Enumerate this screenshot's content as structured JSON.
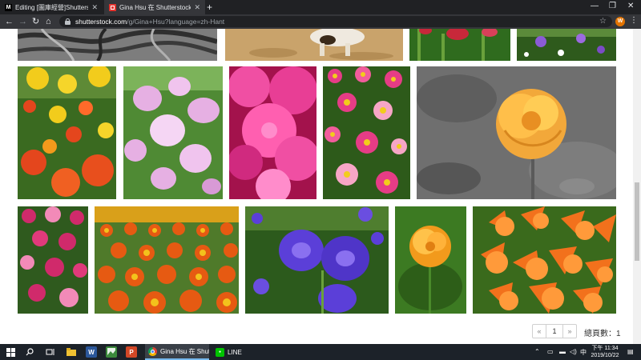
{
  "browser": {
    "tabs": [
      {
        "favicon": "M",
        "title": "Editing [圖庫經營]Shutterstock...",
        "active": false
      },
      {
        "favicon": "",
        "title": "Gina Hsu 在 Shutterstock 的作品...",
        "active": true
      }
    ],
    "new_tab": "+",
    "window_controls": {
      "minimize": "—",
      "maximize": "❐",
      "close": "✕"
    },
    "nav": {
      "back": "←",
      "forward": "→",
      "reload": "↻",
      "home": "⌂"
    },
    "url_host": "shutterstock.com",
    "url_rest": "/g/Gina+Hsu?language=zh-Hant",
    "bookmark_star": "☆",
    "profile_initial": "W",
    "menu_icon": "⋮"
  },
  "gallery": {
    "photos": [
      {
        "id": "roots-bw",
        "subject": "tree roots",
        "colors": [
          "#7a7a7a",
          "#2e2e2e",
          "#b5b5b5"
        ]
      },
      {
        "id": "sand-animal",
        "subject": "animal on sand",
        "colors": [
          "#c9a36b",
          "#a88550",
          "#e8e0d0"
        ]
      },
      {
        "id": "tulips-red",
        "subject": "red tulips",
        "colors": [
          "#2f6b1e",
          "#c8283a",
          "#6aa13b"
        ]
      },
      {
        "id": "flowers-purple-top",
        "subject": "purple flowers",
        "colors": [
          "#2e5a1c",
          "#8b5bd6",
          "#ffffff"
        ]
      },
      {
        "id": "yellow-red-poppies",
        "subject": "yellow and red flowers",
        "colors": [
          "#3a6a20",
          "#f2cc1c",
          "#e4461d"
        ]
      },
      {
        "id": "pink-bellflowers",
        "subject": "pink bellflowers",
        "colors": [
          "#4f8a34",
          "#e6b0e3",
          "#f5d6f4"
        ]
      },
      {
        "id": "pink-asters",
        "subject": "pink asters",
        "colors": [
          "#c3175f",
          "#f04fa3",
          "#ff8ccb"
        ]
      },
      {
        "id": "pink-daisies",
        "subject": "pink daisies",
        "colors": [
          "#2d5a1a",
          "#e63c86",
          "#f7a6c6"
        ]
      },
      {
        "id": "orange-rose-bw",
        "subject": "orange rose",
        "colors": [
          "#6f6f6f",
          "#f2a83a",
          "#ffcc55"
        ]
      },
      {
        "id": "magenta-daisies",
        "subject": "magenta daisies",
        "colors": [
          "#2f5a1e",
          "#d02a6b",
          "#f28ab8"
        ]
      },
      {
        "id": "calendula-field",
        "subject": "orange flower field",
        "colors": [
          "#4f7a2a",
          "#e65a12",
          "#f3c21c"
        ]
      },
      {
        "id": "purple-bellflowers",
        "subject": "purple bellflowers",
        "colors": [
          "#2c5a1c",
          "#5b3fd8",
          "#8a70f0"
        ]
      },
      {
        "id": "orange-rose-green",
        "subject": "orange rose",
        "colors": [
          "#3c7a22",
          "#f29a1c",
          "#ffc24a"
        ]
      },
      {
        "id": "orange-lilies",
        "subject": "orange lilies",
        "colors": [
          "#3a6a1c",
          "#f2711c",
          "#ff9a3a"
        ]
      }
    ]
  },
  "pagination": {
    "prev": "«",
    "current_page": "1",
    "next": "»",
    "total_label": "總頁數：1"
  },
  "taskbar": {
    "start_icon": "windows-logo",
    "apps": [
      {
        "name": "chrome",
        "label": "Gina Hsu 在 Shutte...",
        "active": true
      },
      {
        "name": "line",
        "label": "LINE",
        "active": false
      }
    ],
    "tray_input": "中",
    "clock_time": "下午 11:34",
    "clock_date": "2019/10/22"
  }
}
